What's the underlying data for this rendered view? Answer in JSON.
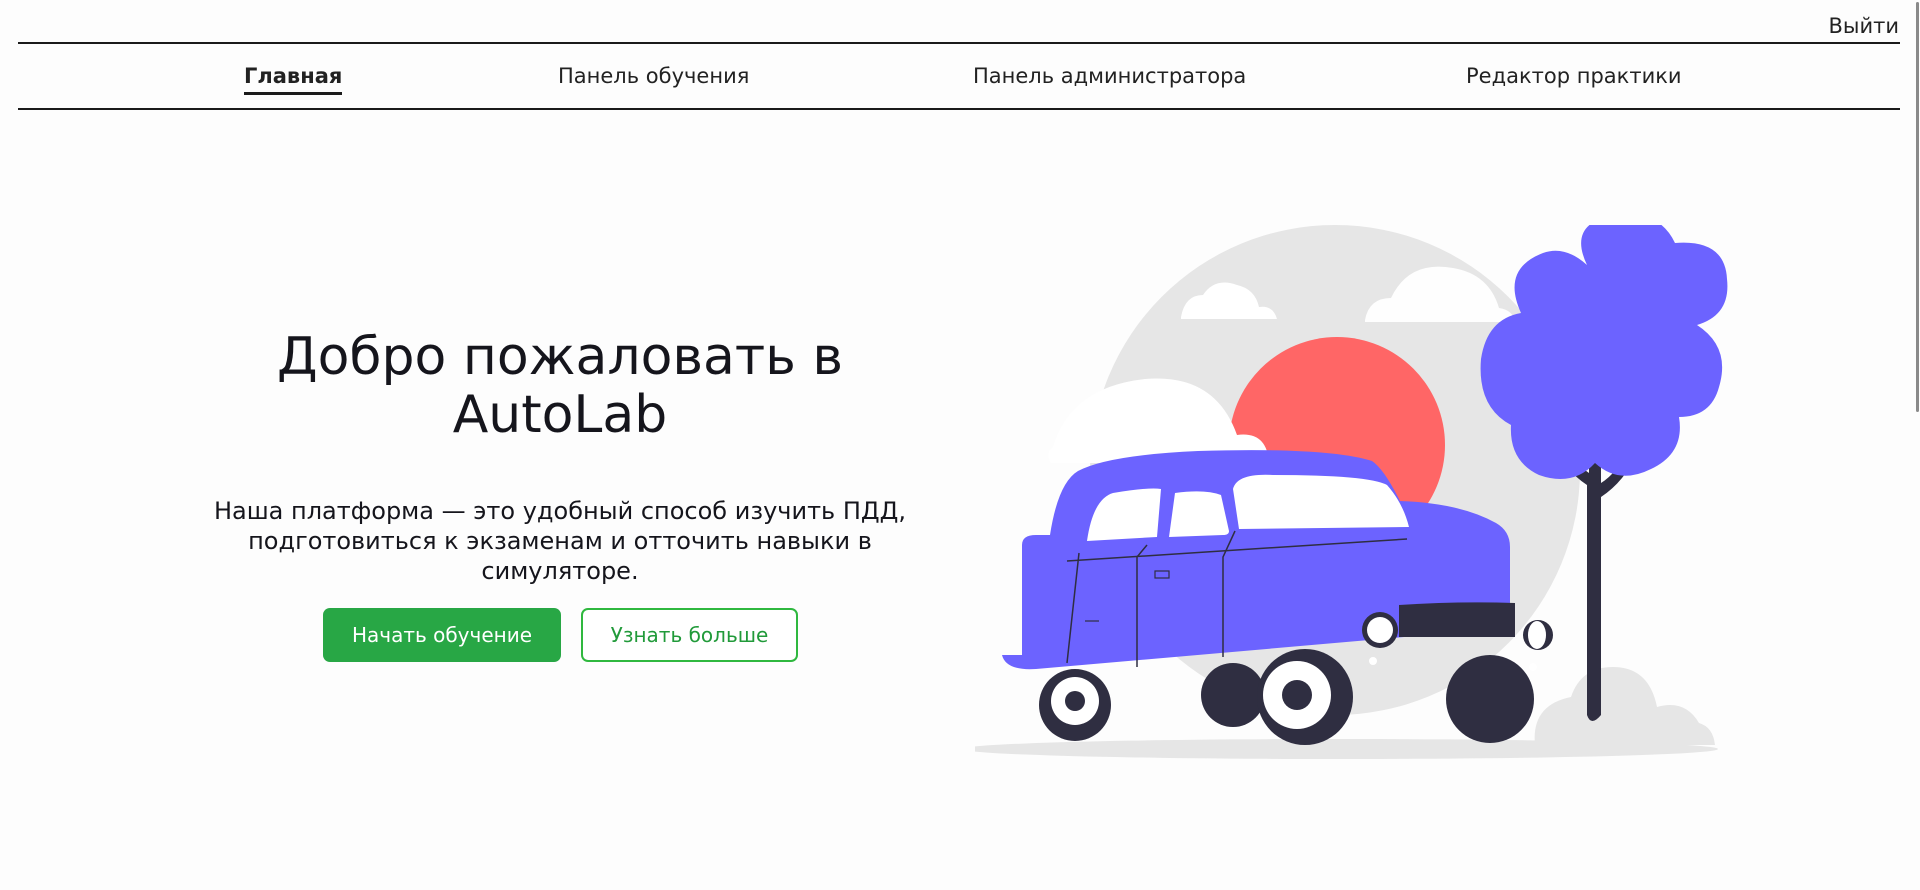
{
  "header": {
    "logout_label": "Выйти"
  },
  "nav": {
    "items": [
      {
        "label": "Главная",
        "active": true
      },
      {
        "label": "Панель обучения",
        "active": false
      },
      {
        "label": "Панель администратора",
        "active": false
      },
      {
        "label": "Редактор практики",
        "active": false
      }
    ]
  },
  "hero": {
    "title_line1": "Добро пожаловать в",
    "title_line2": "AutoLab",
    "description_line1": "Наша платформа — это удобный способ изучить ПДД,",
    "description_line2": "подготовиться к экзаменам и отточить навыки в",
    "description_line3": "симуляторе.",
    "primary_button": "Начать обучение",
    "secondary_button": "Узнать больше"
  },
  "illustration": {
    "car_color": "#6c63ff",
    "sun_color": "#ff6666",
    "tree_color": "#6c63ff",
    "trunk_color": "#2f2e41",
    "cloud_color": "#e6e6e6"
  },
  "colors": {
    "accent_green": "#28a745",
    "text": "#15151c"
  }
}
